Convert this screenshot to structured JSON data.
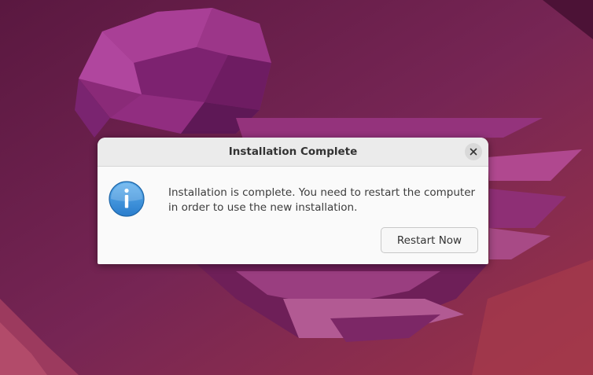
{
  "dialog": {
    "title": "Installation Complete",
    "message_line1": "Installation is complete. You need to restart the computer",
    "message_line2": "in order to use the new installation.",
    "restart_label": "Restart Now",
    "close_icon": "close-icon",
    "info_icon": "info-icon"
  },
  "colors": {
    "wallpaper_base": "#6e1f4e",
    "wallpaper_accent": "#a63d8c",
    "info_blue": "#3a8fd9"
  }
}
